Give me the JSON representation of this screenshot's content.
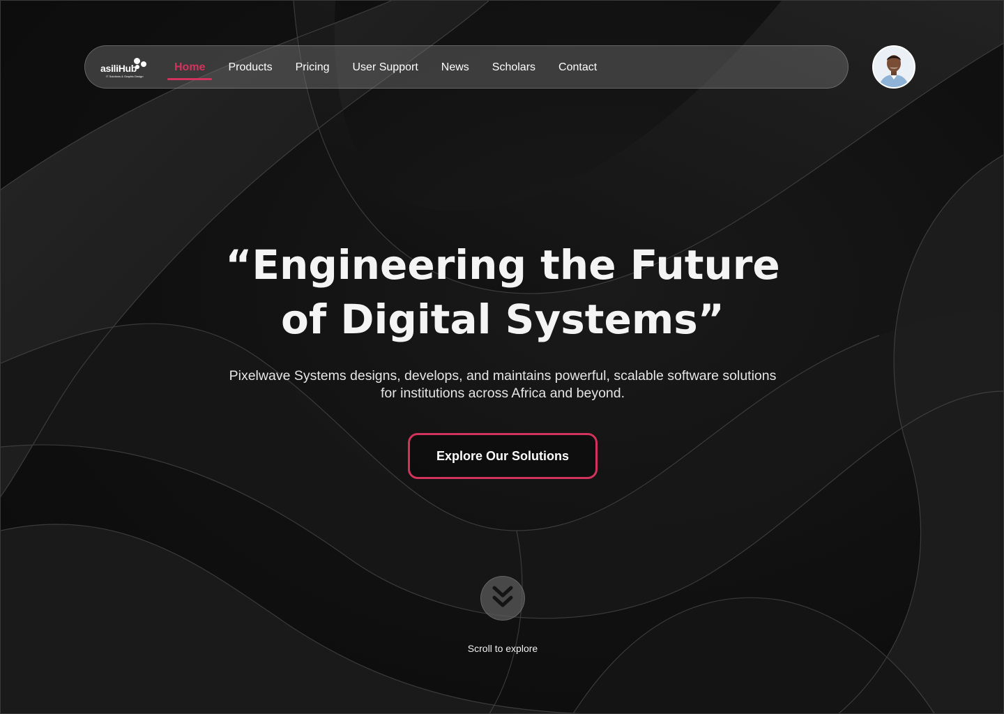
{
  "nav": {
    "logo_text": "asiliHub",
    "logo_tagline": "IT Solutions & Graphic Design",
    "items": [
      {
        "label": "Home",
        "active": true
      },
      {
        "label": "Products",
        "active": false
      },
      {
        "label": "Pricing",
        "active": false
      },
      {
        "label": "User Support",
        "active": false
      },
      {
        "label": "News",
        "active": false
      },
      {
        "label": "Scholars",
        "active": false
      },
      {
        "label": "Contact",
        "active": false
      }
    ]
  },
  "hero": {
    "title_line1": "“Engineering the Future",
    "title_line2": "of Digital Systems”",
    "subtitle_line1": "Pixelwave Systems designs, develops, and maintains powerful, scalable software solutions",
    "subtitle_line2": "for institutions across Africa and beyond.",
    "cta_label": "Explore Our Solutions"
  },
  "scroll": {
    "label": "Scroll to explore",
    "icon": "chevron-double-down-icon"
  },
  "colors": {
    "accent": "#d2335c",
    "background": "#0f0f0f",
    "text": "#f2f2f2"
  },
  "avatar": {
    "icon": "user-avatar-photo"
  }
}
